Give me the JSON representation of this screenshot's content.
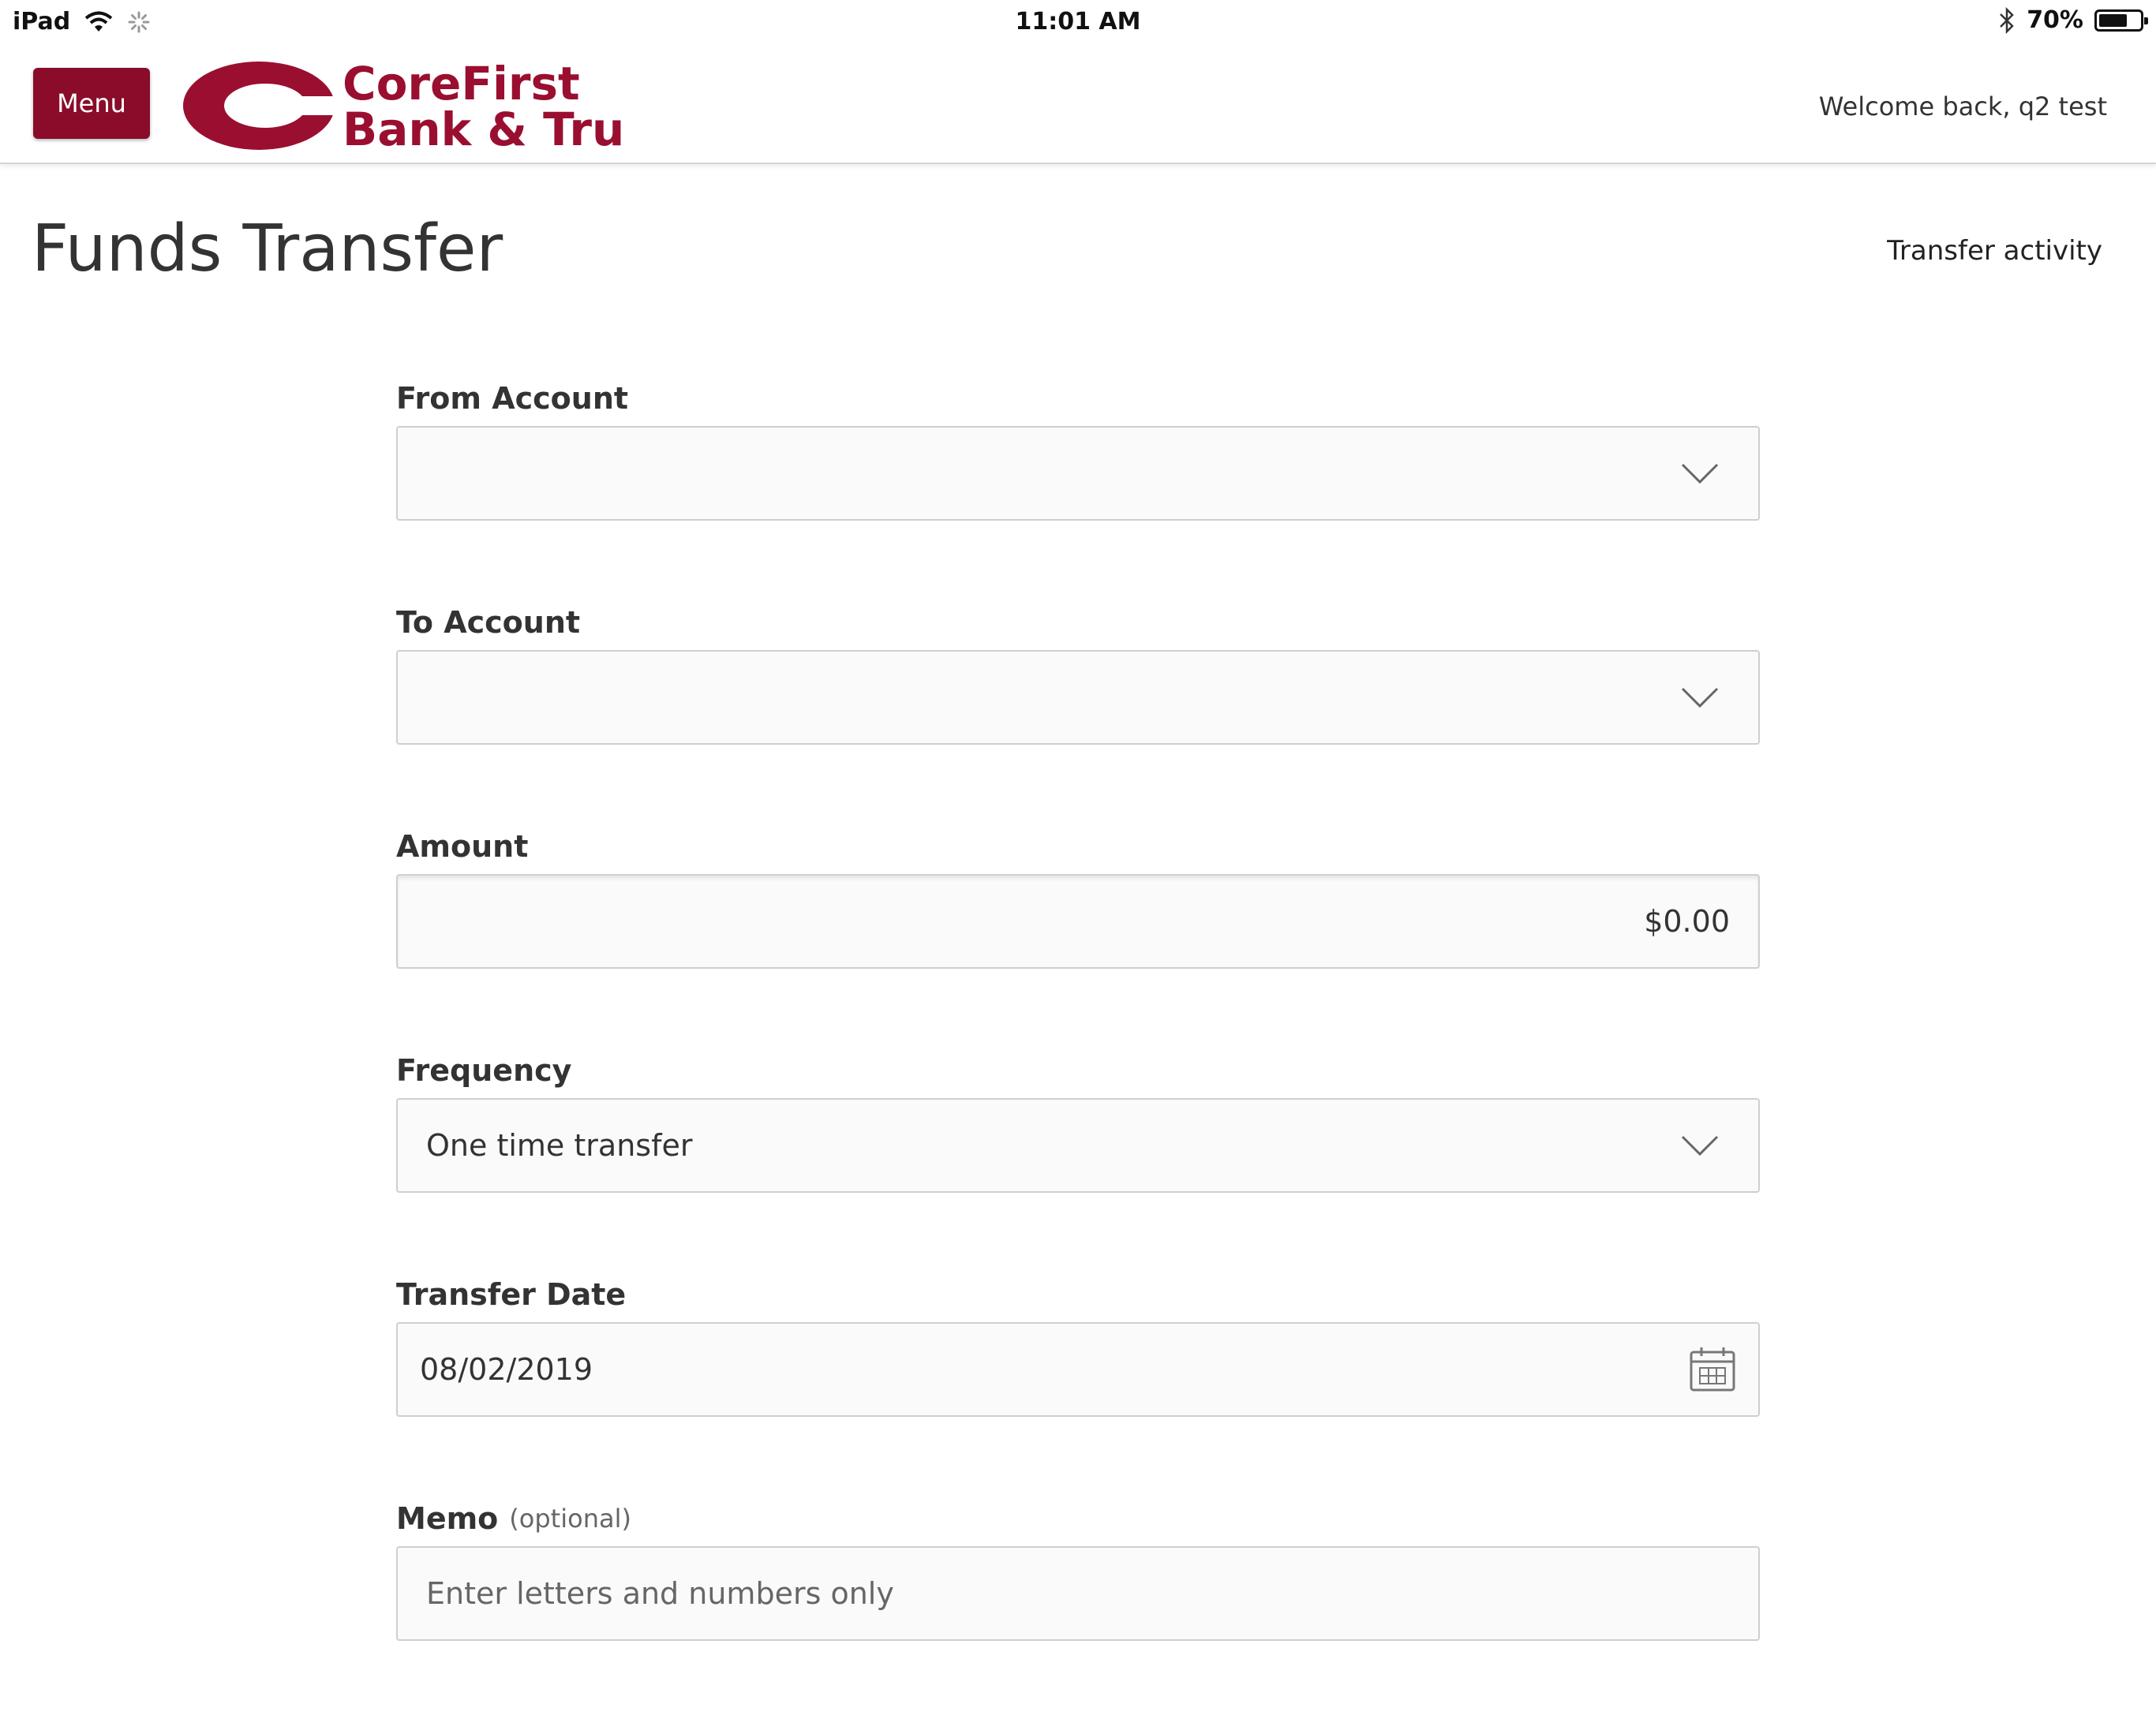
{
  "status_bar": {
    "device": "iPad",
    "time": "11:01 AM",
    "battery_text": "70%",
    "battery_level": 0.7,
    "icons": [
      "wifi-icon",
      "activity-spinner-icon",
      "bluetooth-icon",
      "battery-icon"
    ]
  },
  "header": {
    "menu_label": "Menu",
    "logo_line1": "CoreFirst",
    "logo_line2": "Bank & Trust",
    "welcome": "Welcome back, q2 test",
    "brand_color": "#8a0c2a"
  },
  "page": {
    "title": "Funds Transfer",
    "transfer_activity_link": "Transfer activity"
  },
  "form": {
    "from_account": {
      "label": "From Account",
      "value": ""
    },
    "to_account": {
      "label": "To Account",
      "value": ""
    },
    "amount": {
      "label": "Amount",
      "value": "$0.00"
    },
    "frequency": {
      "label": "Frequency",
      "value": "One time transfer"
    },
    "transfer_date": {
      "label": "Transfer Date",
      "value": "08/02/2019"
    },
    "memo": {
      "label": "Memo",
      "optional": "(optional)",
      "placeholder": "Enter letters and numbers only"
    }
  }
}
